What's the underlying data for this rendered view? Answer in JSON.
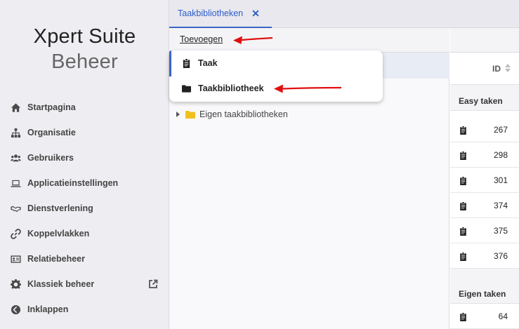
{
  "brand": {
    "line1": "Xpert Suite",
    "line2": "Beheer"
  },
  "sidebar": {
    "items": [
      {
        "label": "Startpagina",
        "icon": "home-icon"
      },
      {
        "label": "Organisatie",
        "icon": "sitemap-icon"
      },
      {
        "label": "Gebruikers",
        "icon": "users-icon"
      },
      {
        "label": "Applicatieinstellingen",
        "icon": "laptop-icon"
      },
      {
        "label": "Dienstverlening",
        "icon": "handshake-icon"
      },
      {
        "label": "Koppelvlakken",
        "icon": "link-icon"
      },
      {
        "label": "Relatiebeheer",
        "icon": "id-card-icon"
      },
      {
        "label": "Klassiek beheer",
        "icon": "gear-icon",
        "external_icon": "external-link-icon"
      },
      {
        "label": "Inklappen",
        "icon": "chevron-left-circle-icon"
      }
    ]
  },
  "tabs": [
    {
      "label": "Taakbibliotheken",
      "close": "✕"
    }
  ],
  "toolbar": {
    "add_label": "Toevoegen"
  },
  "dropdown": {
    "items": [
      {
        "label": "Taak",
        "icon": "clipboard-icon"
      },
      {
        "label": "Taakbibliotheek",
        "icon": "folder-icon"
      }
    ]
  },
  "tree": {
    "label": "Eigen taakbibliotheken",
    "icon": "folder-icon",
    "folder_color": "#f2c01e"
  },
  "table": {
    "id_header": "ID",
    "groups": [
      {
        "label": "Easy taken",
        "rows": [
          "267",
          "298",
          "301",
          "374",
          "375",
          "376"
        ]
      },
      {
        "label": "Eigen taken",
        "rows": [
          "64"
        ]
      }
    ]
  },
  "colors": {
    "accent": "#3d64c8",
    "arrow": "#e01010"
  }
}
